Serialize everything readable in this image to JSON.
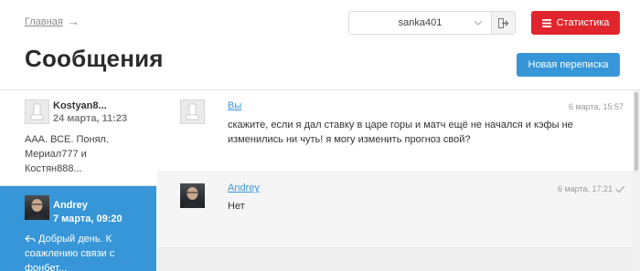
{
  "breadcrumb": {
    "home_label": "Главная",
    "arrow": "→"
  },
  "header": {
    "account": "sanka401",
    "stats_label": "Статистика",
    "title": "Сообщения",
    "new_thread_label": "Новая переписка"
  },
  "conversations": [
    {
      "name": "Kostyan8...",
      "date": "24 марта, 11:23",
      "preview": "ААА. ВСЕ. Понял. Мериал777 и Костян888...",
      "active": false,
      "avatar": "default-user-icon"
    },
    {
      "name": "Andrey",
      "date": "7 марта, 09:20",
      "preview": "Добрый день. К соажлению связи с фонбет...",
      "active": true,
      "avatar": "user-photo",
      "reply_icon": "reply-arrow-icon"
    }
  ],
  "messages": [
    {
      "author": "Вы",
      "time": "6 марта, 15:57",
      "text": "скажите, если я дал ставку в царе горы и матч ещё не начался и кэфы не изменились ни чуть! я могу изменить прогноз свой?",
      "avatar": "default-user-icon"
    },
    {
      "author": "Andrey",
      "time": "6 марта, 17:21",
      "text": "Нет",
      "avatar": "user-photo",
      "read_icon": "checkmark-icon"
    }
  ],
  "colors": {
    "accent_blue": "#3796d8",
    "stats_red": "#e0262c",
    "active_conv_bg": "#3796d8"
  },
  "icons": {
    "account_dropdown": "chevron-down-icon",
    "logout": "logout-icon",
    "stats": "menu-bars-icon"
  }
}
